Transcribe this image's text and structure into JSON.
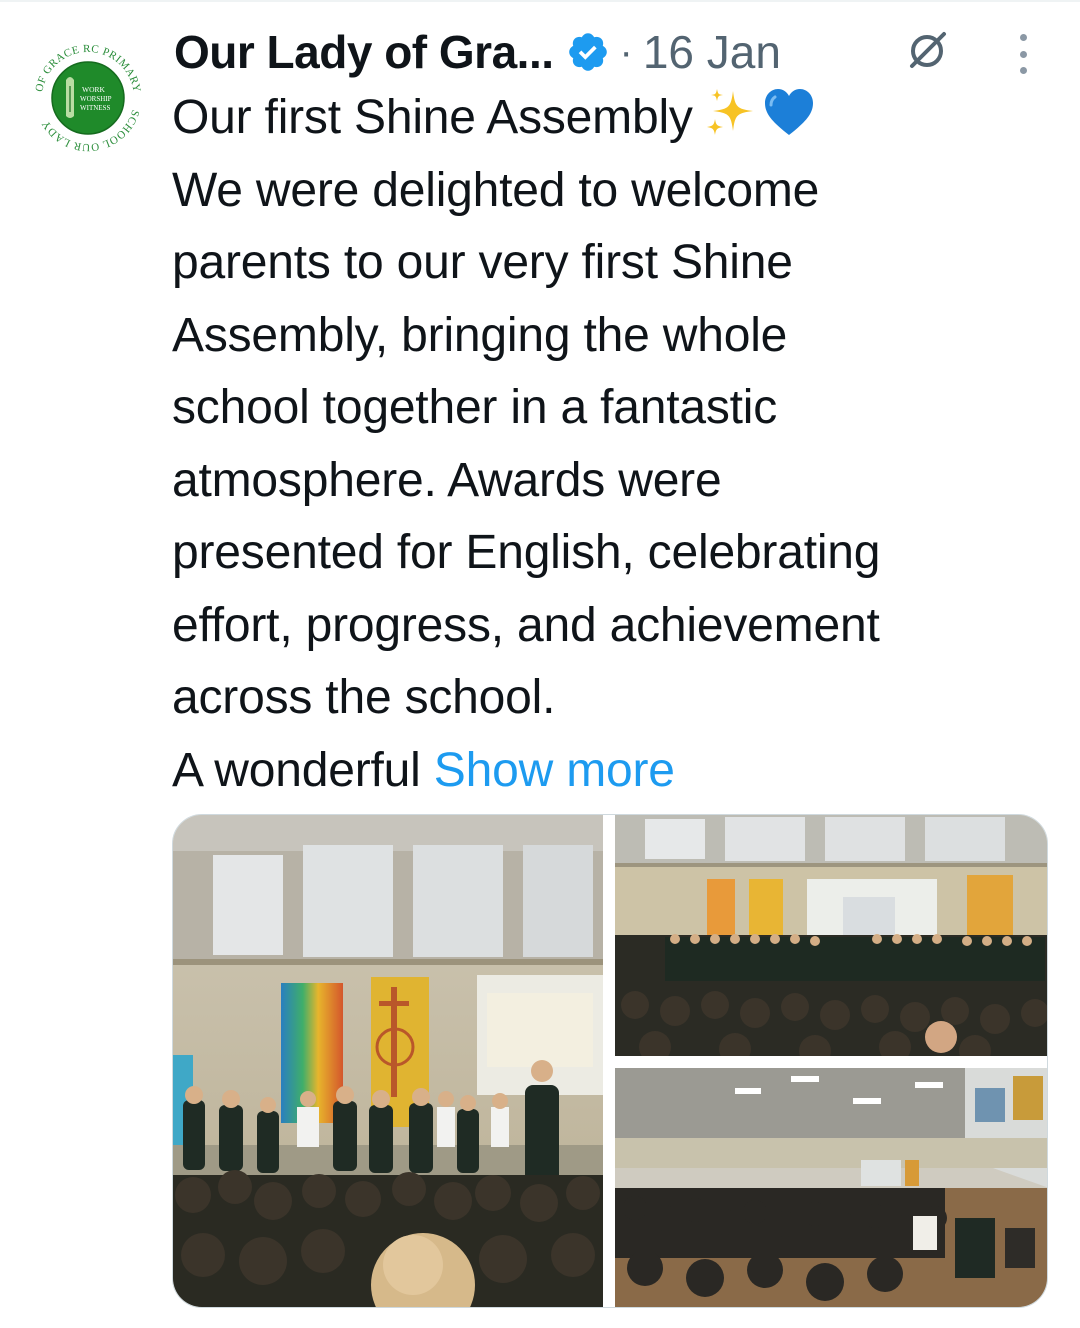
{
  "post": {
    "author": {
      "display_name": "Our Lady of Gra...",
      "avatar_icon": "school-crest-logo",
      "avatar_text": {
        "ring_top": "OF GRACE RC PRIMARY",
        "ring_bottom": "SCHOOL OUR LADY",
        "center_line_1": "WORK",
        "center_line_2": "WORSHIP",
        "center_line_3": "WITNESS"
      },
      "verified_icon": "verified-badge-icon"
    },
    "separator": "·",
    "date": "16 Jan",
    "header_icons": [
      "grok-icon",
      "more-options-icon"
    ],
    "text_lines": [
      "Our first Shine Assembly",
      "We were delighted to welcome",
      "parents to our very first Shine",
      "Assembly, bringing the whole",
      "school together in a fantastic",
      "atmosphere. Awards were",
      "presented for English, celebrating",
      "effort, progress, and achievement",
      "across the school.",
      "A wonderful"
    ],
    "emojis": [
      "sparkles-emoji",
      "blue-heart-emoji"
    ],
    "show_more_label": "Show more",
    "media": [
      {
        "name": "photo-students-on-stage",
        "description_icon": "photo"
      },
      {
        "name": "photo-assembly-hall-wide",
        "description_icon": "photo"
      },
      {
        "name": "photo-hall-audience",
        "description_icon": "photo"
      }
    ]
  },
  "colors": {
    "text": "#0f1419",
    "secondary": "#536471",
    "link": "#1d9bf0",
    "verified": "#1d9bf0",
    "logo_green": "#1f8a2a"
  }
}
